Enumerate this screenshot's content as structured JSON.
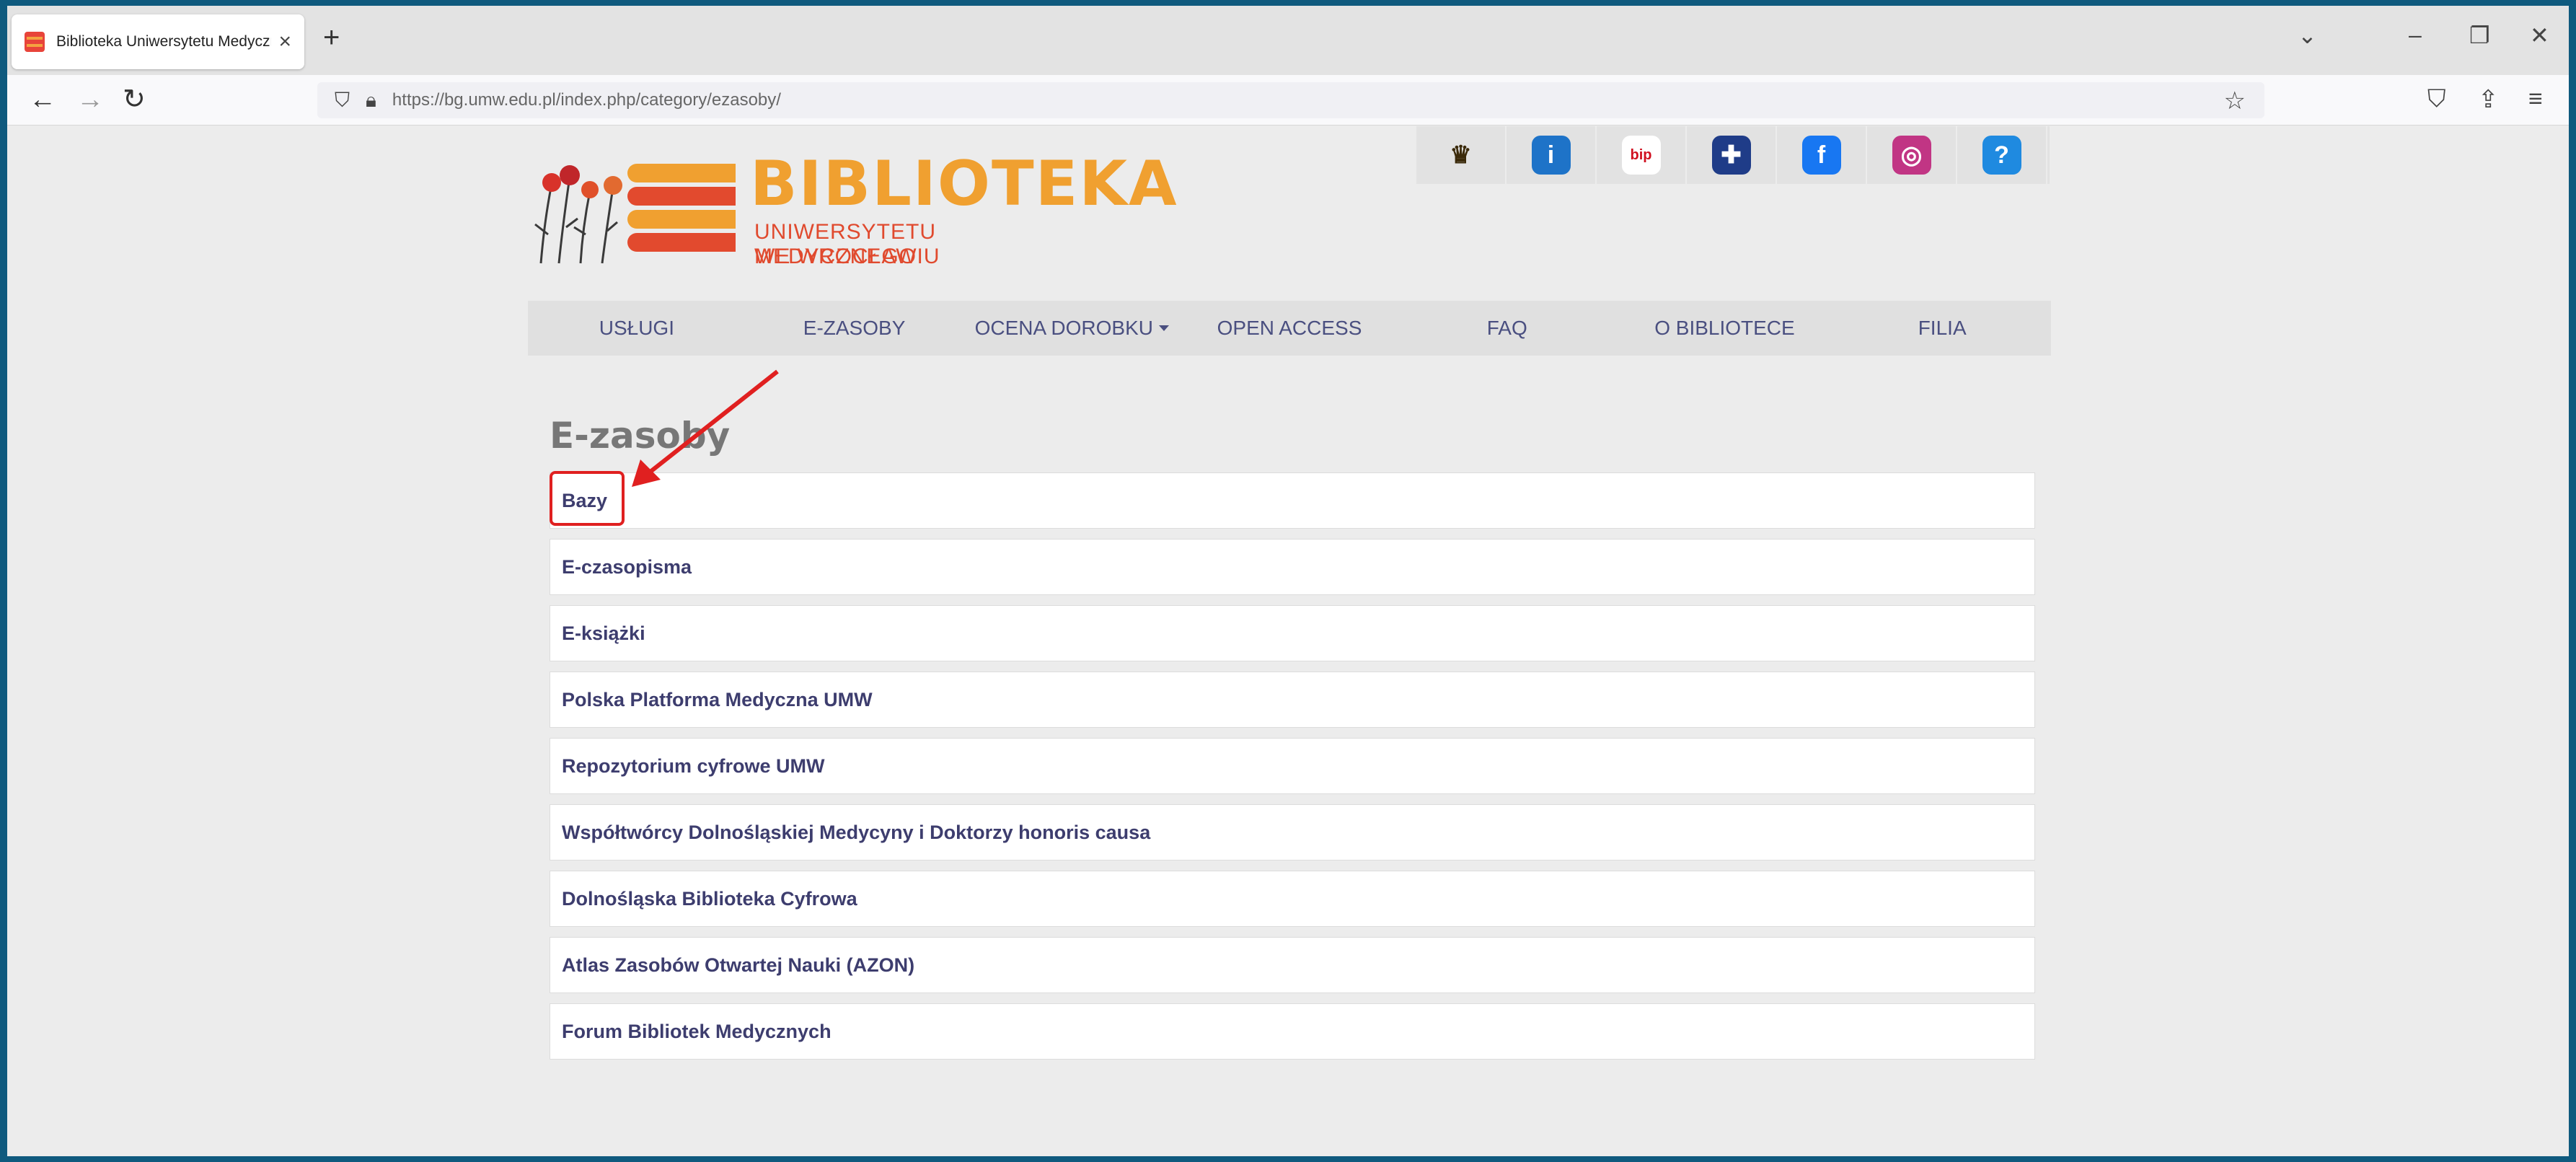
{
  "browser": {
    "tab_title": "Biblioteka Uniwersytetu Medyczn",
    "tab_close": "×",
    "new_tab": "+",
    "url": "https://bg.umw.edu.pl/index.php/category/ezasoby/",
    "window_controls": [
      "⌄",
      "–",
      "❐",
      "✕"
    ]
  },
  "header": {
    "logo_title": "BIBLIOTEKA",
    "logo_line1": "UNIWERSYTETU MEDYCZNEGO",
    "logo_line2": "WE WROCŁAWIU",
    "top_icons": [
      {
        "name": "crest-icon",
        "glyph": "♛",
        "bg": "#e2e2e2",
        "fg": "#3b2a0a"
      },
      {
        "name": "info-icon",
        "glyph": "i",
        "bg": "#1e73c8",
        "fg": "#ffffff"
      },
      {
        "name": "bip-icon",
        "glyph": "bip",
        "bg": "#ffffff",
        "fg": "#d01020"
      },
      {
        "name": "uk-flag-icon",
        "glyph": "✚",
        "bg": "#1f3c88",
        "fg": "#ffffff"
      },
      {
        "name": "facebook-icon",
        "glyph": "f",
        "bg": "#1877f2",
        "fg": "#ffffff"
      },
      {
        "name": "instagram-icon",
        "glyph": "◎",
        "bg": "#c13584",
        "fg": "#ffffff"
      },
      {
        "name": "help-icon",
        "glyph": "?",
        "bg": "#1f8ae0",
        "fg": "#ffffff"
      }
    ]
  },
  "menu": {
    "items": [
      {
        "label": "USŁUGI",
        "dropdown": false
      },
      {
        "label": "E-ZASOBY",
        "dropdown": false
      },
      {
        "label": "OCENA DOROBKU",
        "dropdown": true
      },
      {
        "label": "OPEN ACCESS",
        "dropdown": false
      },
      {
        "label": "FAQ",
        "dropdown": false
      },
      {
        "label": "O BIBLIOTECE",
        "dropdown": false
      },
      {
        "label": "FILIA",
        "dropdown": false
      }
    ]
  },
  "main": {
    "heading": "E-zasoby",
    "items": [
      "Bazy",
      "E-czasopisma",
      "E-książki",
      "Polska Platforma Medyczna UMW",
      "Repozytorium cyfrowe UMW",
      "Współtwórcy Dolnośląskiej Medycyny i Doktorzy honoris causa",
      "Dolnośląska Biblioteka Cyfrowa",
      "Atlas Zasobów Otwartej Nauki (AZON)",
      "Forum Bibliotek Medycznych"
    ]
  },
  "colors": {
    "accent_red": "#e02020",
    "menu_text": "#4a4f80",
    "logo_orange": "#f0a030"
  }
}
